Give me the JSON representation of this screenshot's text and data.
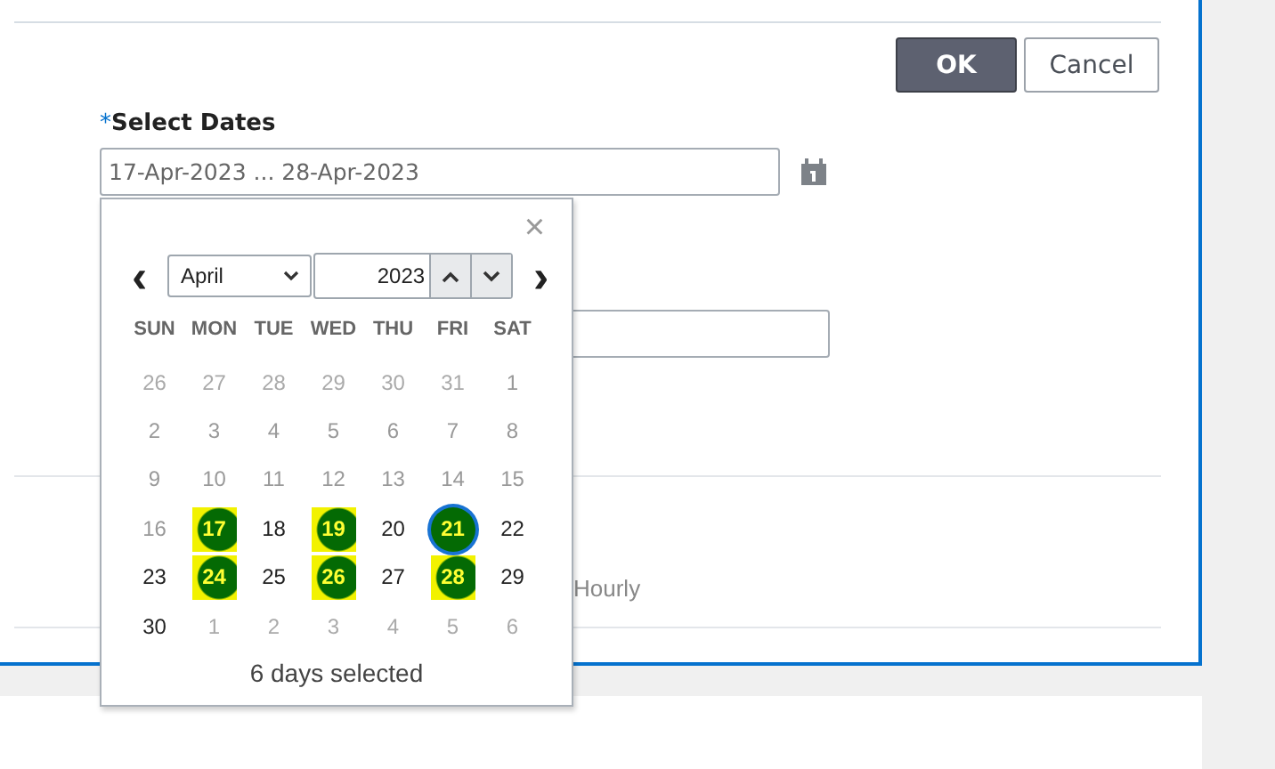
{
  "buttons": [
    {
      "label": "OK",
      "kind": "primary"
    },
    {
      "label": "Cancel",
      "kind": "secondary"
    }
  ],
  "select_dates": {
    "required_mark": "*",
    "label": "Select Dates",
    "value": "17-Apr-2023 ... 28-Apr-2023"
  },
  "frequency_option": "Hourly",
  "calendar": {
    "close": "×",
    "prev": "‹",
    "next": "›",
    "month": "April",
    "year": "2023",
    "weekdays": [
      "SUN",
      "MON",
      "TUE",
      "WED",
      "THU",
      "FRI",
      "SAT"
    ],
    "days": [
      {
        "day": "26",
        "kind": "other",
        "selected": false,
        "highlighted": false
      },
      {
        "day": "27",
        "kind": "other",
        "selected": false,
        "highlighted": false
      },
      {
        "day": "28",
        "kind": "other",
        "selected": false,
        "highlighted": false
      },
      {
        "day": "29",
        "kind": "other",
        "selected": false,
        "highlighted": false
      },
      {
        "day": "30",
        "kind": "other",
        "selected": false,
        "highlighted": false
      },
      {
        "day": "31",
        "kind": "other",
        "selected": false,
        "highlighted": false
      },
      {
        "day": "1",
        "kind": "disabled",
        "selected": false,
        "highlighted": false
      },
      {
        "day": "2",
        "kind": "disabled",
        "selected": false,
        "highlighted": false
      },
      {
        "day": "3",
        "kind": "disabled",
        "selected": false,
        "highlighted": false
      },
      {
        "day": "4",
        "kind": "disabled",
        "selected": false,
        "highlighted": false
      },
      {
        "day": "5",
        "kind": "disabled",
        "selected": false,
        "highlighted": false
      },
      {
        "day": "6",
        "kind": "disabled",
        "selected": false,
        "highlighted": false
      },
      {
        "day": "7",
        "kind": "disabled",
        "selected": false,
        "highlighted": false
      },
      {
        "day": "8",
        "kind": "disabled",
        "selected": false,
        "highlighted": false
      },
      {
        "day": "9",
        "kind": "disabled",
        "selected": false,
        "highlighted": false
      },
      {
        "day": "10",
        "kind": "disabled",
        "selected": false,
        "highlighted": false
      },
      {
        "day": "11",
        "kind": "disabled",
        "selected": false,
        "highlighted": false
      },
      {
        "day": "12",
        "kind": "disabled",
        "selected": false,
        "highlighted": false
      },
      {
        "day": "13",
        "kind": "disabled",
        "selected": false,
        "highlighted": false
      },
      {
        "day": "14",
        "kind": "disabled",
        "selected": false,
        "highlighted": false
      },
      {
        "day": "15",
        "kind": "disabled",
        "selected": false,
        "highlighted": false
      },
      {
        "day": "16",
        "kind": "disabled",
        "selected": false,
        "highlighted": false
      },
      {
        "day": "17",
        "kind": "current",
        "selected": true,
        "highlighted": true
      },
      {
        "day": "18",
        "kind": "current",
        "selected": false,
        "highlighted": false
      },
      {
        "day": "19",
        "kind": "current",
        "selected": true,
        "highlighted": true
      },
      {
        "day": "20",
        "kind": "current",
        "selected": false,
        "highlighted": false
      },
      {
        "day": "21",
        "kind": "current",
        "selected": true,
        "highlighted": false
      },
      {
        "day": "22",
        "kind": "current",
        "selected": false,
        "highlighted": false
      },
      {
        "day": "23",
        "kind": "current",
        "selected": false,
        "highlighted": false
      },
      {
        "day": "24",
        "kind": "current",
        "selected": true,
        "highlighted": true
      },
      {
        "day": "25",
        "kind": "current",
        "selected": false,
        "highlighted": false
      },
      {
        "day": "26",
        "kind": "current",
        "selected": true,
        "highlighted": true
      },
      {
        "day": "27",
        "kind": "current",
        "selected": false,
        "highlighted": false
      },
      {
        "day": "28",
        "kind": "current",
        "selected": true,
        "highlighted": true
      },
      {
        "day": "29",
        "kind": "current",
        "selected": false,
        "highlighted": false
      },
      {
        "day": "30",
        "kind": "current",
        "selected": false,
        "highlighted": false
      },
      {
        "day": "1",
        "kind": "other",
        "selected": false,
        "highlighted": false
      },
      {
        "day": "2",
        "kind": "other",
        "selected": false,
        "highlighted": false
      },
      {
        "day": "3",
        "kind": "other",
        "selected": false,
        "highlighted": false
      },
      {
        "day": "4",
        "kind": "other",
        "selected": false,
        "highlighted": false
      },
      {
        "day": "5",
        "kind": "other",
        "selected": false,
        "highlighted": false
      },
      {
        "day": "6",
        "kind": "other",
        "selected": false,
        "highlighted": false
      }
    ],
    "summary": "6 days selected"
  }
}
